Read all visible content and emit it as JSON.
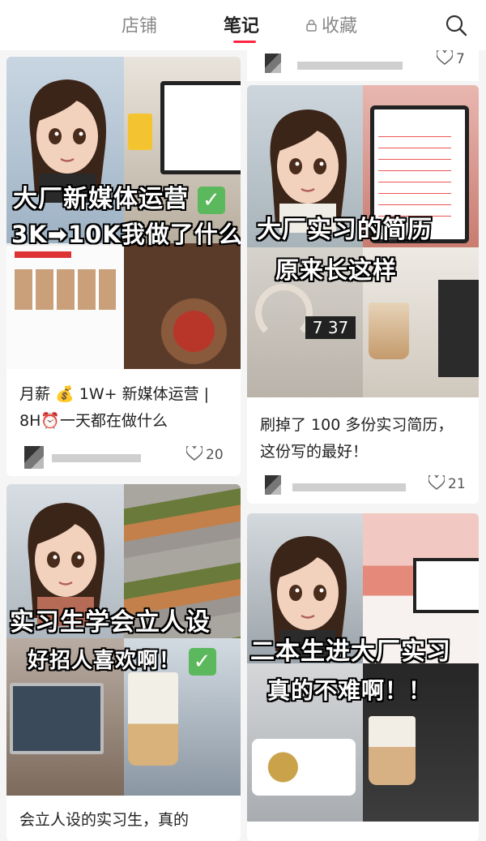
{
  "tabs": {
    "store": "店铺",
    "notes": "笔记",
    "favorites": "收藏"
  },
  "top_partial": {
    "likes": "7"
  },
  "cards": [
    {
      "overlay_line1": "大厂新媒体运营",
      "overlay_line2": "3K➡10K我做了什么",
      "title": "月薪 💰 1W+ 新媒体运营 | 8H⏰一天都在做什么",
      "likes": "20"
    },
    {
      "overlay_line1": "大厂实习的简历",
      "overlay_line2": "原来长这样",
      "title": "刷掉了 100 多份实习简历，这份写的最好！",
      "likes": "21"
    },
    {
      "overlay_line1": "实习生学会立人设",
      "overlay_line2": "好招人喜欢啊！",
      "title": "会立人设的实习生，真的",
      "likes": ""
    },
    {
      "overlay_line1": "二本生进大厂实习",
      "overlay_line2": "真的不难啊！！",
      "title": "",
      "likes": ""
    }
  ],
  "colors": {
    "accent": "#ff2442",
    "check": "#5cb85c"
  }
}
